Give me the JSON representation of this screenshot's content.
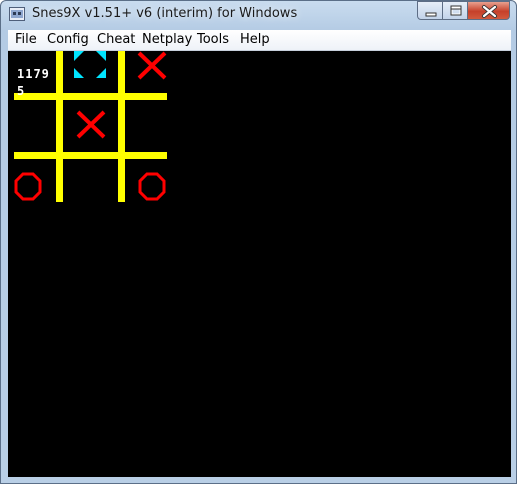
{
  "window": {
    "title": "Snes9X v1.51+ v6 (interim) for Windows"
  },
  "menu": {
    "items": [
      "File",
      "Config",
      "Cheat",
      "Netplay",
      "Tools",
      "Help"
    ]
  },
  "game": {
    "counter_top": "1179",
    "counter_bottom": "5",
    "board_color": "#ffff00",
    "x_color": "#ff0000",
    "o_color": "#ff0000",
    "cursor_color": "#00e5ff",
    "cells": [
      [
        "cursor",
        "",
        "X"
      ],
      [
        "",
        "X",
        ""
      ],
      [
        "O",
        "",
        "O"
      ]
    ]
  }
}
